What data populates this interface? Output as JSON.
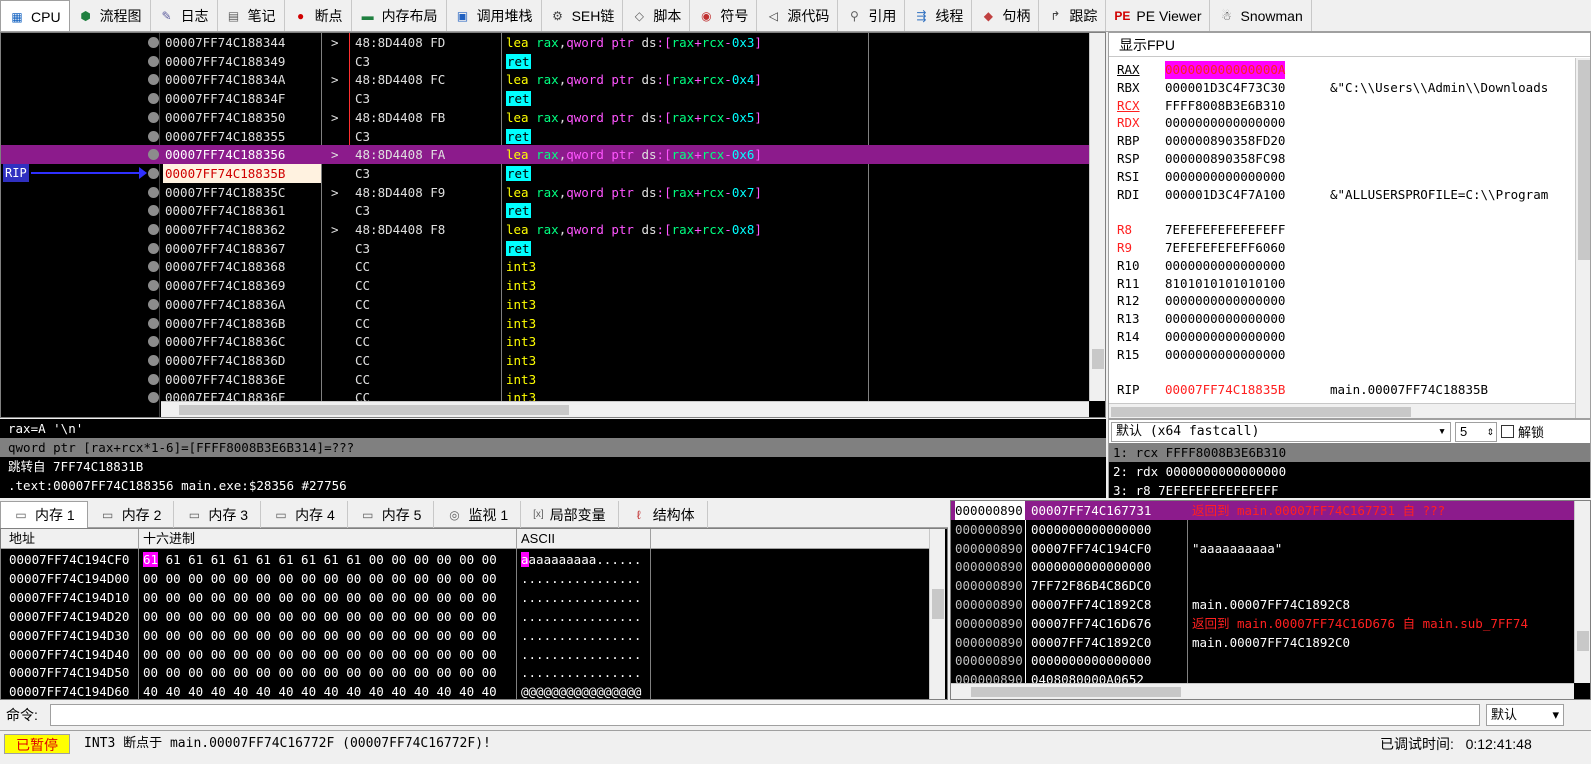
{
  "tabs": [
    {
      "label": "CPU",
      "icon": "cpu-icon",
      "glyph": "▦"
    },
    {
      "label": "流程图",
      "icon": "graph-icon",
      "glyph": "⬢"
    },
    {
      "label": "日志",
      "icon": "log-icon",
      "glyph": "✎"
    },
    {
      "label": "笔记",
      "icon": "notes-icon",
      "glyph": "▤"
    },
    {
      "label": "断点",
      "icon": "breakpoint-icon",
      "glyph": "●"
    },
    {
      "label": "内存布局",
      "icon": "memory-map-icon",
      "glyph": "▬"
    },
    {
      "label": "调用堆栈",
      "icon": "callstack-icon",
      "glyph": "▣"
    },
    {
      "label": "SEH链",
      "icon": "seh-icon",
      "glyph": "⚙"
    },
    {
      "label": "脚本",
      "icon": "script-icon",
      "glyph": "◇"
    },
    {
      "label": "符号",
      "icon": "symbol-icon",
      "glyph": "◉"
    },
    {
      "label": "源代码",
      "icon": "source-icon",
      "glyph": "◁"
    },
    {
      "label": "引用",
      "icon": "references-icon",
      "glyph": "⚲"
    },
    {
      "label": "线程",
      "icon": "threads-icon",
      "glyph": "⇶"
    },
    {
      "label": "句柄",
      "icon": "handles-icon",
      "glyph": "◆"
    },
    {
      "label": "跟踪",
      "icon": "trace-icon",
      "glyph": "↱"
    },
    {
      "label": "PE Viewer",
      "icon": "pe-viewer-icon",
      "glyph": "PE"
    },
    {
      "label": "Snowman",
      "icon": "snowman-icon",
      "glyph": "☃"
    }
  ],
  "disasm": {
    "rip_label": "RIP",
    "rows": [
      {
        "addr": "00007FF74C188344",
        "arrow": ">",
        "bytes": "48:8D4408 FD",
        "op": "lea",
        "args": "0x3"
      },
      {
        "addr": "00007FF74C188349",
        "arrow": "",
        "bytes": "C3",
        "op": "ret"
      },
      {
        "addr": "00007FF74C18834A",
        "arrow": ">",
        "bytes": "48:8D4408 FC",
        "op": "lea",
        "args": "0x4"
      },
      {
        "addr": "00007FF74C18834F",
        "arrow": "",
        "bytes": "C3",
        "op": "ret"
      },
      {
        "addr": "00007FF74C188350",
        "arrow": ">",
        "bytes": "48:8D4408 FB",
        "op": "lea",
        "args": "0x5"
      },
      {
        "addr": "00007FF74C188355",
        "arrow": "",
        "bytes": "C3",
        "op": "ret"
      },
      {
        "addr": "00007FF74C188356",
        "arrow": ">",
        "bytes": "48:8D4408 FA",
        "op": "lea",
        "args": "0x6",
        "selected": true
      },
      {
        "addr": "00007FF74C18835B",
        "arrow": "",
        "bytes": "C3",
        "op": "ret",
        "rip": true
      },
      {
        "addr": "00007FF74C18835C",
        "arrow": ">",
        "bytes": "48:8D4408 F9",
        "op": "lea",
        "args": "0x7"
      },
      {
        "addr": "00007FF74C188361",
        "arrow": "",
        "bytes": "C3",
        "op": "ret"
      },
      {
        "addr": "00007FF74C188362",
        "arrow": ">",
        "bytes": "48:8D4408 F8",
        "op": "lea",
        "args": "0x8"
      },
      {
        "addr": "00007FF74C188367",
        "arrow": "",
        "bytes": "C3",
        "op": "ret"
      },
      {
        "addr": "00007FF74C188368",
        "arrow": "",
        "bytes": "CC",
        "op": "int3"
      },
      {
        "addr": "00007FF74C188369",
        "arrow": "",
        "bytes": "CC",
        "op": "int3"
      },
      {
        "addr": "00007FF74C18836A",
        "arrow": "",
        "bytes": "CC",
        "op": "int3"
      },
      {
        "addr": "00007FF74C18836B",
        "arrow": "",
        "bytes": "CC",
        "op": "int3"
      },
      {
        "addr": "00007FF74C18836C",
        "arrow": "",
        "bytes": "CC",
        "op": "int3"
      },
      {
        "addr": "00007FF74C18836D",
        "arrow": "",
        "bytes": "CC",
        "op": "int3"
      },
      {
        "addr": "00007FF74C18836E",
        "arrow": "",
        "bytes": "CC",
        "op": "int3"
      },
      {
        "addr": "00007FF74C18836F",
        "arrow": "",
        "bytes": "CC",
        "op": "int3"
      }
    ],
    "lea_prefix": "rax,qword ptr ds:[rax+rcx-"
  },
  "registers": {
    "header": "显示FPU",
    "rows": [
      {
        "name": "RAX",
        "value": "000000000000000A",
        "comment": "",
        "style": "rax"
      },
      {
        "name": "RBX",
        "value": "000001D3C4F73C30",
        "comment": "&\"C:\\\\Users\\\\Admin\\\\Downloads",
        "style": ""
      },
      {
        "name": "RCX",
        "value": "FFFF8008B3E6B310",
        "comment": "",
        "style": "rcx"
      },
      {
        "name": "RDX",
        "value": "0000000000000000",
        "comment": "",
        "style": "redname"
      },
      {
        "name": "RBP",
        "value": "000000890358FD20",
        "comment": "",
        "style": ""
      },
      {
        "name": "RSP",
        "value": "000000890358FC98",
        "comment": "",
        "style": ""
      },
      {
        "name": "RSI",
        "value": "0000000000000000",
        "comment": "",
        "style": ""
      },
      {
        "name": "RDI",
        "value": "000001D3C4F7A100",
        "comment": "&\"ALLUSERSPROFILE=C:\\\\Program",
        "style": ""
      },
      {
        "name": "R8",
        "value": "7EFEFEFEFEFEFEFF",
        "comment": "",
        "style": "redname",
        "gap": true
      },
      {
        "name": "R9",
        "value": "7EFEFEFEFEFF6060",
        "comment": "",
        "style": "redname"
      },
      {
        "name": "R10",
        "value": "0000000000000000",
        "comment": "",
        "style": ""
      },
      {
        "name": "R11",
        "value": "8101010101010100",
        "comment": "",
        "style": ""
      },
      {
        "name": "R12",
        "value": "0000000000000000",
        "comment": "",
        "style": ""
      },
      {
        "name": "R13",
        "value": "0000000000000000",
        "comment": "",
        "style": ""
      },
      {
        "name": "R14",
        "value": "0000000000000000",
        "comment": "",
        "style": ""
      },
      {
        "name": "R15",
        "value": "0000000000000000",
        "comment": "",
        "style": ""
      },
      {
        "name": "RIP",
        "value": "00007FF74C18835B",
        "comment": "main.00007FF74C18835B",
        "style": "rip",
        "gap": true
      }
    ]
  },
  "info": {
    "line1": "rax=A '\\n'",
    "line2": "qword ptr [rax+rcx*1-6]=[FFFF8008B3E6B314]=???",
    "line3": "跳转自 7FF74C18831B",
    "line4": ".text:00007FF74C188356 main.exe:$28356 #27756"
  },
  "callconv": {
    "selected": "默认 (x64 fastcall)",
    "count": "5",
    "unlock_label": "解锁",
    "args": [
      "1: rcx FFFF8008B3E6B310",
      "2: rdx 0000000000000000",
      "3: r8 7EFEFEFEFEFEFEFF"
    ]
  },
  "mem_tabs": [
    {
      "label": "内存 1",
      "icon": "memory-icon"
    },
    {
      "label": "内存 2",
      "icon": "memory-icon"
    },
    {
      "label": "内存 3",
      "icon": "memory-icon"
    },
    {
      "label": "内存 4",
      "icon": "memory-icon"
    },
    {
      "label": "内存 5",
      "icon": "memory-icon"
    },
    {
      "label": "监视 1",
      "icon": "watch-icon"
    },
    {
      "label": "局部变量",
      "icon": "locals-icon"
    },
    {
      "label": "结构体",
      "icon": "struct-icon"
    }
  ],
  "dump": {
    "col_addr": "地址",
    "col_hex": "十六进制",
    "col_ascii": "ASCII",
    "rows": [
      {
        "addr": "00007FF74C194CF0",
        "hex": "61 61 61 61 61 61 61 61 61 61 00 00 00 00 00 00",
        "ascii": "aaaaaaaaaa......"
      },
      {
        "addr": "00007FF74C194D00",
        "hex": "00 00 00 00 00 00 00 00 00 00 00 00 00 00 00 00",
        "ascii": "................"
      },
      {
        "addr": "00007FF74C194D10",
        "hex": "00 00 00 00 00 00 00 00 00 00 00 00 00 00 00 00",
        "ascii": "................"
      },
      {
        "addr": "00007FF74C194D20",
        "hex": "00 00 00 00 00 00 00 00 00 00 00 00 00 00 00 00",
        "ascii": "................"
      },
      {
        "addr": "00007FF74C194D30",
        "hex": "00 00 00 00 00 00 00 00 00 00 00 00 00 00 00 00",
        "ascii": "................"
      },
      {
        "addr": "00007FF74C194D40",
        "hex": "00 00 00 00 00 00 00 00 00 00 00 00 00 00 00 00",
        "ascii": "................"
      },
      {
        "addr": "00007FF74C194D50",
        "hex": "00 00 00 00 00 00 00 00 00 00 00 00 00 00 00 00",
        "ascii": "................"
      },
      {
        "addr": "00007FF74C194D60",
        "hex": "40 40 40 40 40 40 40 40 40 40 40 40 40 40 40 40",
        "ascii": "@@@@@@@@@@@@@@@@"
      }
    ]
  },
  "stack": {
    "rows": [
      {
        "addr": "000000890",
        "value": "00007FF74C167731",
        "comment": "返回到 main.00007FF74C167731 自 ???",
        "red": true,
        "selected": true
      },
      {
        "addr": "000000890",
        "value": "0000000000000000",
        "comment": ""
      },
      {
        "addr": "000000890",
        "value": "00007FF74C194CF0",
        "comment": "\"aaaaaaaaaa\""
      },
      {
        "addr": "000000890",
        "value": "0000000000000000",
        "comment": ""
      },
      {
        "addr": "000000890",
        "value": "7FF72F86B4C86DC0",
        "comment": ""
      },
      {
        "addr": "000000890",
        "value": "00007FF74C1892C8",
        "comment": "main.00007FF74C1892C8"
      },
      {
        "addr": "000000890",
        "value": "00007FF74C16D676",
        "comment": "返回到 main.00007FF74C16D676 自 main.sub_7FF74",
        "red": true
      },
      {
        "addr": "000000890",
        "value": "00007FF74C1892C0",
        "comment": "main.00007FF74C1892C0"
      },
      {
        "addr": "000000890",
        "value": "0000000000000000",
        "comment": ""
      },
      {
        "addr": "000000890",
        "value": "0408080000A0652",
        "comment": ""
      }
    ]
  },
  "command": {
    "label": "命令:",
    "value": "",
    "mode": "默认"
  },
  "status": {
    "state": "已暂停",
    "message": "INT3 断点于 main.00007FF74C16772F (00007FF74C16772F)!",
    "time_label": "已调试时间:",
    "time": "0:12:41:48"
  },
  "colors": {
    "selected": "#8c1b8c",
    "highlight": "#ff00ff",
    "paused_bg": "#ffff00",
    "paused_fg": "#e00000"
  }
}
